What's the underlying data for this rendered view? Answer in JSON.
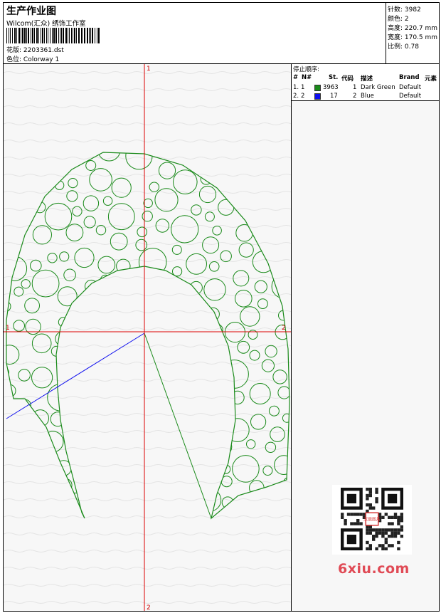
{
  "header": {
    "title": "生产作业图",
    "subtitle": "Wilcom(汇众) 绣饰工作室",
    "design_label": "花版:",
    "design_value": "2203361.dst",
    "color_label": "色位:",
    "color_value": "Colorway 1"
  },
  "stats": {
    "stitches": "针数: 3982",
    "colors": "颜色: 2",
    "height": "高度: 220.7 mm",
    "width": "宽度: 170.5 mm",
    "scale": "比例: 0.78"
  },
  "axis_labels": {
    "top": "1",
    "bottom": "2",
    "left": "1",
    "right": "2"
  },
  "stop_sequence": {
    "heading": "停止顺序:",
    "columns": [
      "#",
      "N#",
      "St.",
      "代码",
      "描述",
      "Brand",
      "元素"
    ],
    "rows": [
      {
        "num": "1.",
        "n": "1",
        "color": "#1a8a1a",
        "stitches": "3963",
        "code": "1",
        "description": "Dark Green",
        "brand": "Default"
      },
      {
        "num": "2.",
        "n": "2",
        "color": "#1010ee",
        "stitches": "17",
        "code": "2",
        "description": "Blue",
        "brand": "Default"
      }
    ]
  },
  "watermark": {
    "qr_text": "汉鼎图片",
    "logo": "6xiu.com"
  }
}
